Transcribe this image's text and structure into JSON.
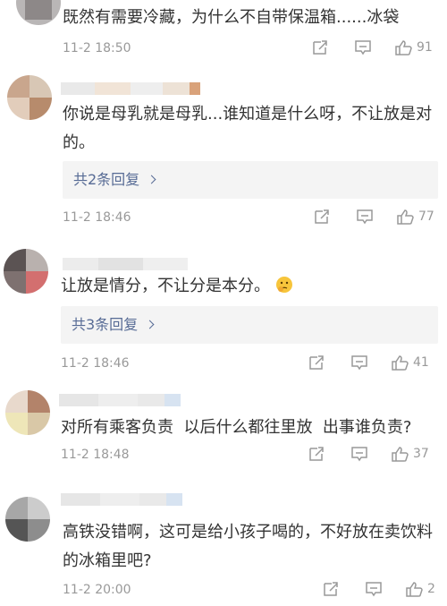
{
  "comments": [
    {
      "text": "既然有需要冷藏，为什么不自带保温箱......冰袋",
      "time": "11-2 18:50",
      "likes": "91"
    },
    {
      "text": "你说是母乳就是母乳...谁知道是什么呀，不让放是对的。",
      "replies": "共2条回复",
      "time": "11-2 18:46",
      "likes": "77"
    },
    {
      "text": "让放是情分，不让分是本分。",
      "emoji": "thinking-face-emoji",
      "replies": "共3条回复",
      "time": "11-2 18:46",
      "likes": "41"
    },
    {
      "text": "对所有乘客负责  以后什么都往里放  出事谁负责?",
      "time": "11-2 18:48",
      "likes": "37"
    },
    {
      "text": "高铁没错啊，这可是给小孩子喝的，不好放在卖饮料的冰箱里吧?",
      "time": "11-2 20:00",
      "likes": "2"
    }
  ],
  "icons": {
    "share": "share-icon",
    "reply": "comment-icon",
    "like": "thumbs-up-icon"
  },
  "colors": {
    "text": "#333333",
    "meta": "#999999",
    "reply_link": "#576b95",
    "reply_bg": "#f4f4f4"
  }
}
